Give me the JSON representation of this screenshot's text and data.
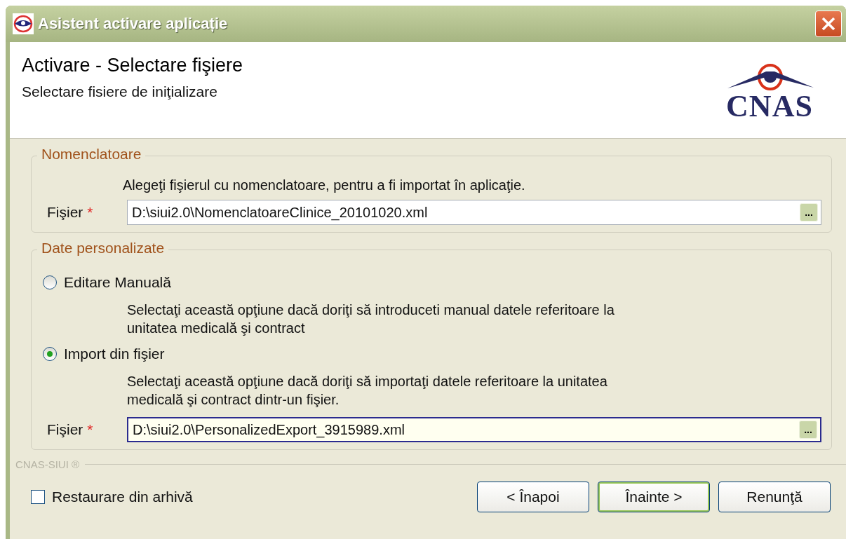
{
  "window": {
    "title": "Asistent activare aplicație"
  },
  "header": {
    "title": "Activare - Selectare fişiere",
    "subtitle": "Selectare fisiere de iniţializare",
    "logo_text": "CNAS"
  },
  "nomenclatoare": {
    "legend": "Nomenclatoare",
    "description": "Alegeţi fişierul cu nomenclatoare, pentru a fi importat în aplicaţie.",
    "file": {
      "label": "Fişier",
      "required_mark": "*",
      "value": "D:\\siui2.0\\NomenclatoareClinice_20101020.xml",
      "focused": false,
      "browse_label": "..."
    }
  },
  "date_personalizate": {
    "legend": "Date personalizate",
    "options": [
      {
        "label": "Editare Manuală",
        "selected": false,
        "description": "Selectaţi această opţiune dacă doriţi să introduceti manual datele referitoare la unitatea medicală şi contract"
      },
      {
        "label": "Import din fişier",
        "selected": true,
        "description": "Selectaţi această opţiune dacă doriţi să importaţi datele referitoare la unitatea medicală şi contract dintr-un fişier."
      }
    ],
    "file": {
      "label": "Fişier",
      "required_mark": "*",
      "value": "D:\\siui2.0\\PersonalizedExport_3915989.xml",
      "focused": true,
      "browse_label": "..."
    }
  },
  "footer": {
    "brand": "CNAS-SIUI ®",
    "checkbox": {
      "label": "Restaurare din arhivă",
      "checked": false
    },
    "buttons": [
      {
        "label": "< Înapoi",
        "default": false
      },
      {
        "label": "Înainte >",
        "default": true
      },
      {
        "label": "Renunţă",
        "default": false
      }
    ]
  }
}
